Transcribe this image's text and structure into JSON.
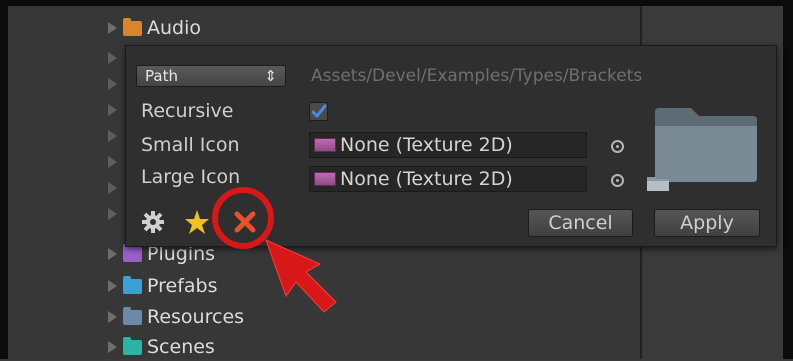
{
  "tree": {
    "items": [
      {
        "label": "Audio",
        "icon": "audio-folder-icon",
        "color": "#d9862a"
      },
      {
        "label": "Plugins",
        "icon": "plugins-folder-icon",
        "color": "#9a5fcf"
      },
      {
        "label": "Prefabs",
        "icon": "prefabs-folder-icon",
        "color": "#3aa0d8"
      },
      {
        "label": "Resources",
        "icon": "resources-folder-icon",
        "color": "#6a8aa8"
      },
      {
        "label": "Scenes",
        "icon": "scenes-folder-icon",
        "color": "#2bb3a4"
      }
    ]
  },
  "popup": {
    "path_dropdown": {
      "label": "Path",
      "arrows": "⇕"
    },
    "path_value": "Assets/Devel/Examples/Types/Brackets",
    "recursive_label": "Recursive",
    "recursive_checked": true,
    "small_icon_label": "Small Icon",
    "small_icon_value": "None (Texture 2D)",
    "large_icon_label": "Large Icon",
    "large_icon_value": "None (Texture 2D)",
    "cancel_label": "Cancel",
    "apply_label": "Apply",
    "icons": [
      "gear-icon",
      "star-icon",
      "delete-icon"
    ]
  },
  "colors": {
    "annotation": "#d81818",
    "accent_check": "#4d8ce6"
  }
}
